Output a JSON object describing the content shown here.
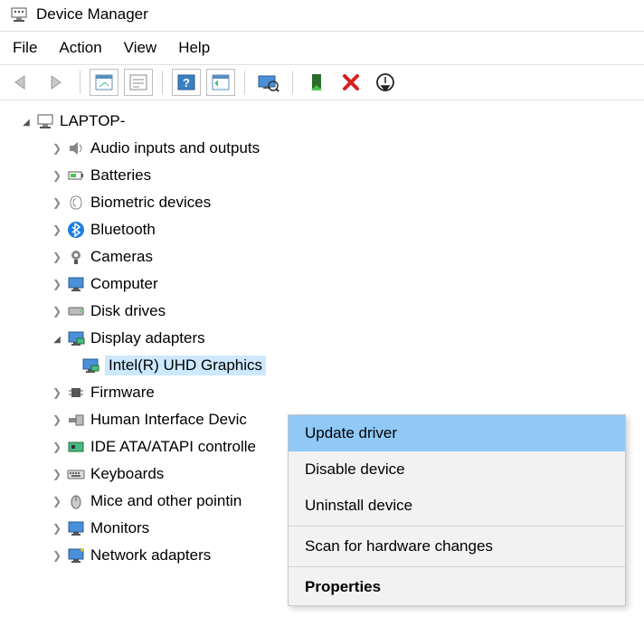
{
  "window": {
    "title": "Device Manager"
  },
  "menu": {
    "file": "File",
    "action": "Action",
    "view": "View",
    "help": "Help"
  },
  "tree": {
    "root": "LAPTOP-",
    "items": [
      {
        "label": "Audio inputs and outputs",
        "icon": "speaker"
      },
      {
        "label": "Batteries",
        "icon": "battery"
      },
      {
        "label": "Biometric devices",
        "icon": "fingerprint"
      },
      {
        "label": "Bluetooth",
        "icon": "bluetooth"
      },
      {
        "label": "Cameras",
        "icon": "camera"
      },
      {
        "label": "Computer",
        "icon": "monitor"
      },
      {
        "label": "Disk drives",
        "icon": "disk"
      },
      {
        "label": "Display adapters",
        "icon": "display",
        "expanded": true,
        "children": [
          {
            "label": "Intel(R) UHD Graphics",
            "icon": "display",
            "selected": true
          }
        ]
      },
      {
        "label": "Firmware",
        "icon": "chip"
      },
      {
        "label": "Human Interface Devic",
        "icon": "hid"
      },
      {
        "label": "IDE ATA/ATAPI controlle",
        "icon": "ide"
      },
      {
        "label": "Keyboards",
        "icon": "keyboard"
      },
      {
        "label": "Mice and other pointin",
        "icon": "mouse"
      },
      {
        "label": "Monitors",
        "icon": "monitor"
      },
      {
        "label": "Network adapters",
        "icon": "network"
      }
    ]
  },
  "context": {
    "update": "Update driver",
    "disable": "Disable device",
    "uninstall": "Uninstall device",
    "scan": "Scan for hardware changes",
    "properties": "Properties"
  }
}
